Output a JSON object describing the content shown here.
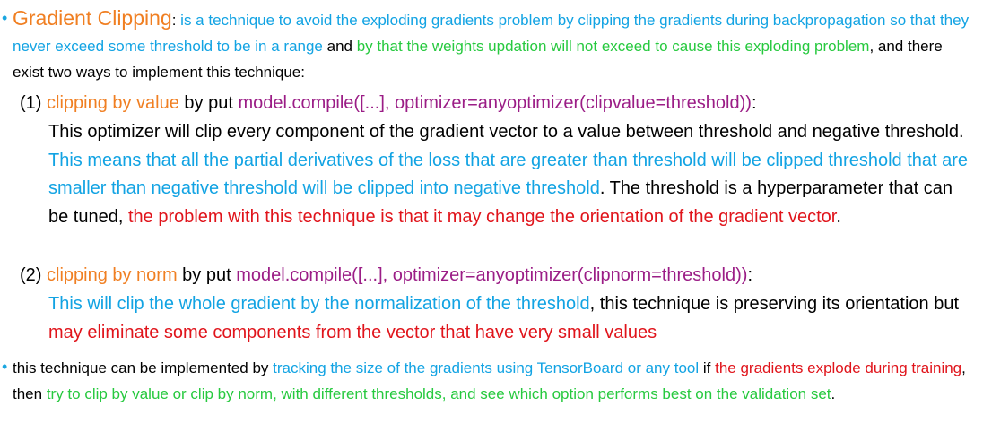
{
  "intro": {
    "title": "Gradient Clipping",
    "colon": ":",
    "seg1": " is a technique to avoid the exploding gradients problem by clipping the gradients during backpropagation so that they never exceed some threshold to be in a range",
    "seg2": " and ",
    "seg3": "by that the weights updation will not exceed to cause this exploding problem",
    "seg4": ", and there exist two ways to implement this technique:"
  },
  "item1": {
    "num": "(1) ",
    "name": "clipping by value",
    "by_put": " by put ",
    "code": "model.compile([...], optimizer=anyoptimizer(clipvalue=threshold))",
    "colon": ":",
    "body1": "This optimizer will clip every component of the gradient vector to a value between threshold and negative threshold. ",
    "body2": "This means that all the partial derivatives of the loss that are greater than threshold will be clipped threshold that are smaller than negative threshold will be clipped into negative threshold",
    "body3": ". The threshold is a hyperparameter that can be tuned, ",
    "body4": "the problem with this technique is that it may change the orientation of the gradient vector",
    "body5": "."
  },
  "item2": {
    "num": "(2) ",
    "name": "clipping by norm",
    "by_put": " by put ",
    "code": "model.compile([...], optimizer=anyoptimizer(clipnorm=threshold))",
    "colon": ":",
    "body1": "This will clip the whole gradient by the normalization of the threshold",
    "body2": ", this technique is preserving its orientation but ",
    "body3": "may eliminate some components from the vector that have very small values"
  },
  "last": {
    "seg1": "this technique can be implemented by ",
    "seg2": "tracking the size of the gradients using TensorBoard or any tool",
    "seg3": " if ",
    "seg4": "the gradients explode during training",
    "seg5": ", then ",
    "seg6": "try to clip by value or clip by norm, with different thresholds, and see which option performs best on the validation set",
    "seg7": "."
  },
  "colors": {
    "orange": "#f07f22",
    "cyan": "#12a3e3",
    "green": "#27c93f",
    "red": "#e0141b",
    "purple": "#9b1d86",
    "bullet": "#1aa6e0"
  },
  "icons": {
    "bullet": "bullet-dot-icon"
  }
}
